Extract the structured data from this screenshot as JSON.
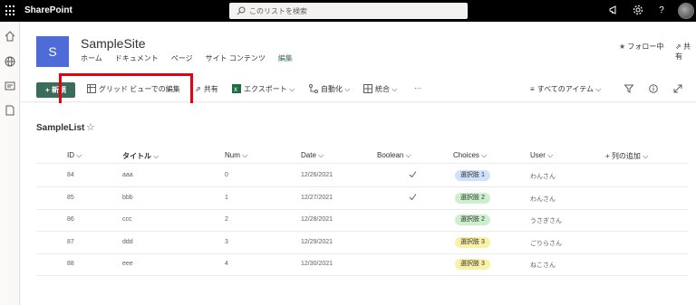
{
  "suitebar": {
    "brand": "SharePoint",
    "search_placeholder": "このリストを検索"
  },
  "site": {
    "logo_letter": "S",
    "name": "SampleSite",
    "nav": [
      "ホーム",
      "ドキュメント",
      "ページ",
      "サイト コンテンツ"
    ],
    "nav_edit": "編集",
    "follow": "フォロー中",
    "share": "共有"
  },
  "commandbar": {
    "new": "新規",
    "grid_edit": "グリッド ビューでの編集",
    "share": "共有",
    "export": "エクスポート",
    "automate": "自動化",
    "integrate": "統合",
    "more": "···",
    "view": "すべてのアイテム"
  },
  "list": {
    "title": "SampleList",
    "columns": {
      "id": "ID",
      "title": "タイトル",
      "num": "Num",
      "date": "Date",
      "boolean": "Boolean",
      "choices": "Choices",
      "user": "User",
      "add": "列の追加"
    },
    "rows": [
      {
        "id": "84",
        "title": "aaa",
        "num": "0",
        "date": "12/26/2021",
        "boolean": true,
        "choice": "選択肢 1",
        "user": "わんさん"
      },
      {
        "id": "85",
        "title": "bbb",
        "num": "1",
        "date": "12/27/2021",
        "boolean": true,
        "choice": "選択肢 2",
        "user": "わんさん"
      },
      {
        "id": "86",
        "title": "ccc",
        "num": "2",
        "date": "12/28/2021",
        "boolean": false,
        "choice": "選択肢 2",
        "user": "うさぎさん"
      },
      {
        "id": "87",
        "title": "ddd",
        "num": "3",
        "date": "12/29/2021",
        "boolean": false,
        "choice": "選択肢 3",
        "user": "ごりらさん"
      },
      {
        "id": "88",
        "title": "eee",
        "num": "4",
        "date": "12/30/2021",
        "boolean": false,
        "choice": "選択肢 3",
        "user": "ねこさん"
      }
    ]
  },
  "colors": {
    "suitebar": "#000000",
    "accent": "#3b6b5a",
    "site_logo": "#4f6bd7",
    "highlight": "#e60012",
    "choice1": "#cfe2fb",
    "choice2": "#caf0cc",
    "choice3": "#f9f1a5"
  },
  "icons": {
    "waffle": "waffle-icon",
    "search": "search-icon",
    "megaphone": "megaphone-icon",
    "settings": "gear-icon",
    "help": "help-icon",
    "home": "home-icon",
    "globe": "globe-icon",
    "news": "news-icon",
    "file": "file-icon",
    "star": "star-icon",
    "share": "share-icon",
    "grid": "grid-icon",
    "excel": "excel-icon",
    "flow": "flow-icon",
    "integrate": "integrate-icon",
    "list-view": "list-view-icon",
    "filter": "filter-icon",
    "info": "info-icon",
    "expand": "expand-icon",
    "check": "check-icon",
    "plus": "plus-icon"
  }
}
